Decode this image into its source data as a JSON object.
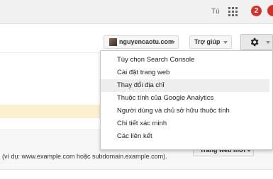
{
  "header": {
    "user_name": "Tú",
    "notification_count": "2",
    "icons": {
      "apps": "apps-grid-icon",
      "notifications": "notification-badge"
    },
    "colors": {
      "badge": "#d93025"
    }
  },
  "toolbar": {
    "account_label": "nguyencaotu.com",
    "help_label": "Trợ giúp",
    "settings_icon": "gear-icon"
  },
  "settings_menu": {
    "items": [
      {
        "label": "Tùy chọn Search Console"
      },
      {
        "label": "Cài đặt trang web"
      },
      {
        "label": "Thay đổi địa chỉ"
      },
      {
        "label": "Thuộc tính của Google Analytics"
      },
      {
        "label": "Người dùng và chủ sở hữu thuộc tính"
      },
      {
        "label": "Chi tiết xác minh"
      },
      {
        "label": "Các liên kết"
      }
    ],
    "highlighted_index": 2
  },
  "main": {
    "help_text": "(ví dụ: www.example.com hoặc subdomain.example.com).",
    "new_site_label": "Trang web mới"
  }
}
